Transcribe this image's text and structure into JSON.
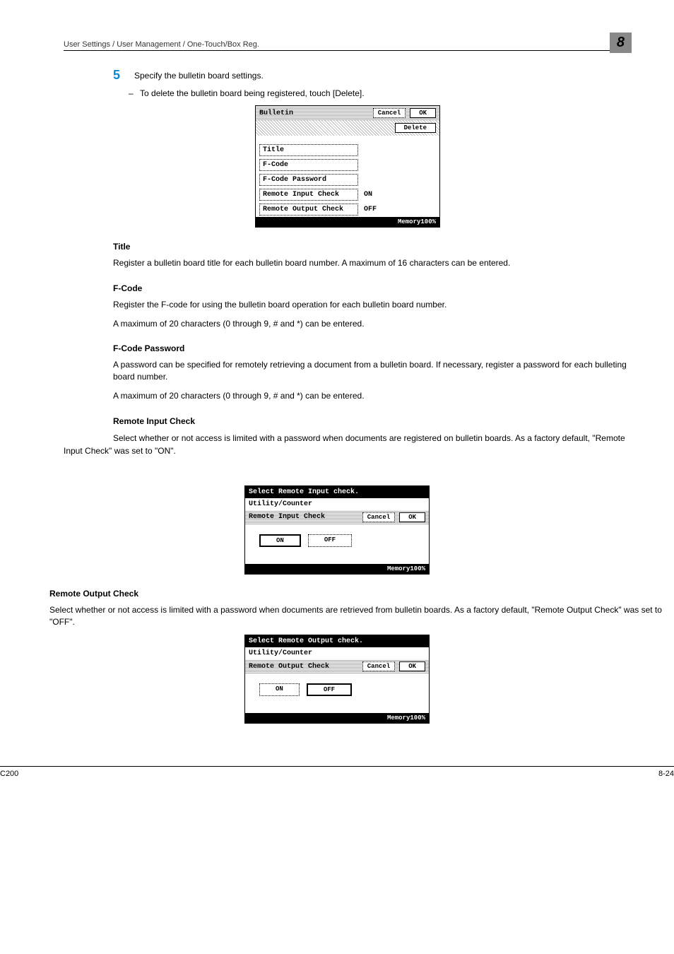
{
  "header": {
    "breadcrumb": "User Settings / User Management / One-Touch/Box Reg.",
    "chapter": "8"
  },
  "step": {
    "number": "5",
    "text": "Specify the bulletin board settings.",
    "sub": "To delete the bulletin board being registered, touch [Delete]."
  },
  "screenshot1": {
    "title": "Bulletin",
    "cancel": "Cancel",
    "ok": "OK",
    "delete": "Delete",
    "fields": {
      "title": "Title",
      "fcode": "F-Code",
      "fcodepw": "F-Code Password",
      "remote_in": "Remote Input Check",
      "remote_in_val": "ON",
      "remote_out": "Remote Output Check",
      "remote_out_val": "OFF"
    },
    "memory": "Memory100%"
  },
  "sections": {
    "title": {
      "h": "Title",
      "p": "Register a bulletin board title for each bulletin board number. A maximum of 16 characters can be entered."
    },
    "fcode": {
      "h": "F-Code",
      "p1": "Register the F-code for using the bulletin board operation for each bulletin board number.",
      "p2": "A maximum of 20 characters (0 through 9, # and *) can be entered."
    },
    "fcodepw": {
      "h": "F-Code Password",
      "p1": "A password can be specified for remotely retrieving a document from a bulletin board. If necessary, register a password for each bulleting board number.",
      "p2": "A maximum of 20 characters (0 through 9, # and *) can be entered."
    },
    "remote_in": {
      "h": "Remote Input Check",
      "p": "Select whether or not access is limited with a password when documents are registered on bulletin boards. As a factory default, \"Remote Input Check\" was set to \"ON\"."
    },
    "remote_out": {
      "h": "Remote Output Check",
      "p": "Select whether or not access is limited with a password when documents are retrieved from bulletin boards. As a factory default, \"Remote Output Check\" was set to \"OFF\"."
    }
  },
  "screenshot2": {
    "header": "Select Remote Input check.",
    "crumb": "Utility/Counter",
    "label": "Remote Input Check",
    "cancel": "Cancel",
    "ok": "OK",
    "on": "ON",
    "off": "OFF",
    "memory": "Memory100%"
  },
  "screenshot3": {
    "header": "Select Remote Output check.",
    "crumb": "Utility/Counter",
    "label": "Remote Output Check",
    "cancel": "Cancel",
    "ok": "OK",
    "on": "ON",
    "off": "OFF",
    "memory": "Memory100%"
  },
  "footer": {
    "left": "C200",
    "right": "8-24"
  }
}
